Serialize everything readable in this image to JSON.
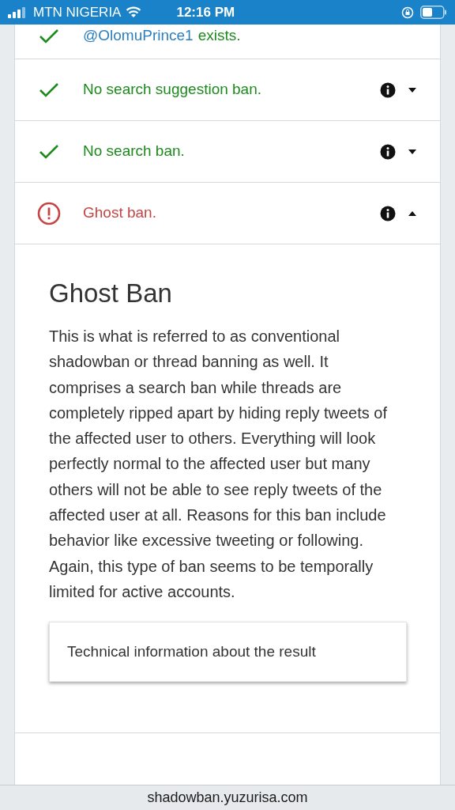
{
  "status_bar": {
    "carrier": "MTN NIGERIA",
    "time": "12:16 PM"
  },
  "results": [
    {
      "kind": "ok",
      "handle": "@OlomuPrince1",
      "label": "exists.",
      "has_details": false
    },
    {
      "kind": "ok",
      "label": "No search suggestion ban.",
      "has_details": true,
      "expanded": false
    },
    {
      "kind": "ok",
      "label": "No search ban.",
      "has_details": true,
      "expanded": false
    },
    {
      "kind": "error",
      "label": "Ghost ban.",
      "has_details": true,
      "expanded": true
    }
  ],
  "details": {
    "title": "Ghost Ban",
    "body": "This is what is referred to as conventional shadowban or thread banning as well. It comprises a search ban while threads are completely ripped apart by hiding reply tweets of the affected user to others. Everything will look perfectly normal to the affected user but many others will not be able to see reply tweets of the affected user at all. Reasons for this ban include behavior like excessive tweeting or following. Again, this type of ban seems to be temporally limited for active accounts.",
    "technical_button": "Technical information about the result"
  },
  "url": "shadowban.yuzurisa.com"
}
